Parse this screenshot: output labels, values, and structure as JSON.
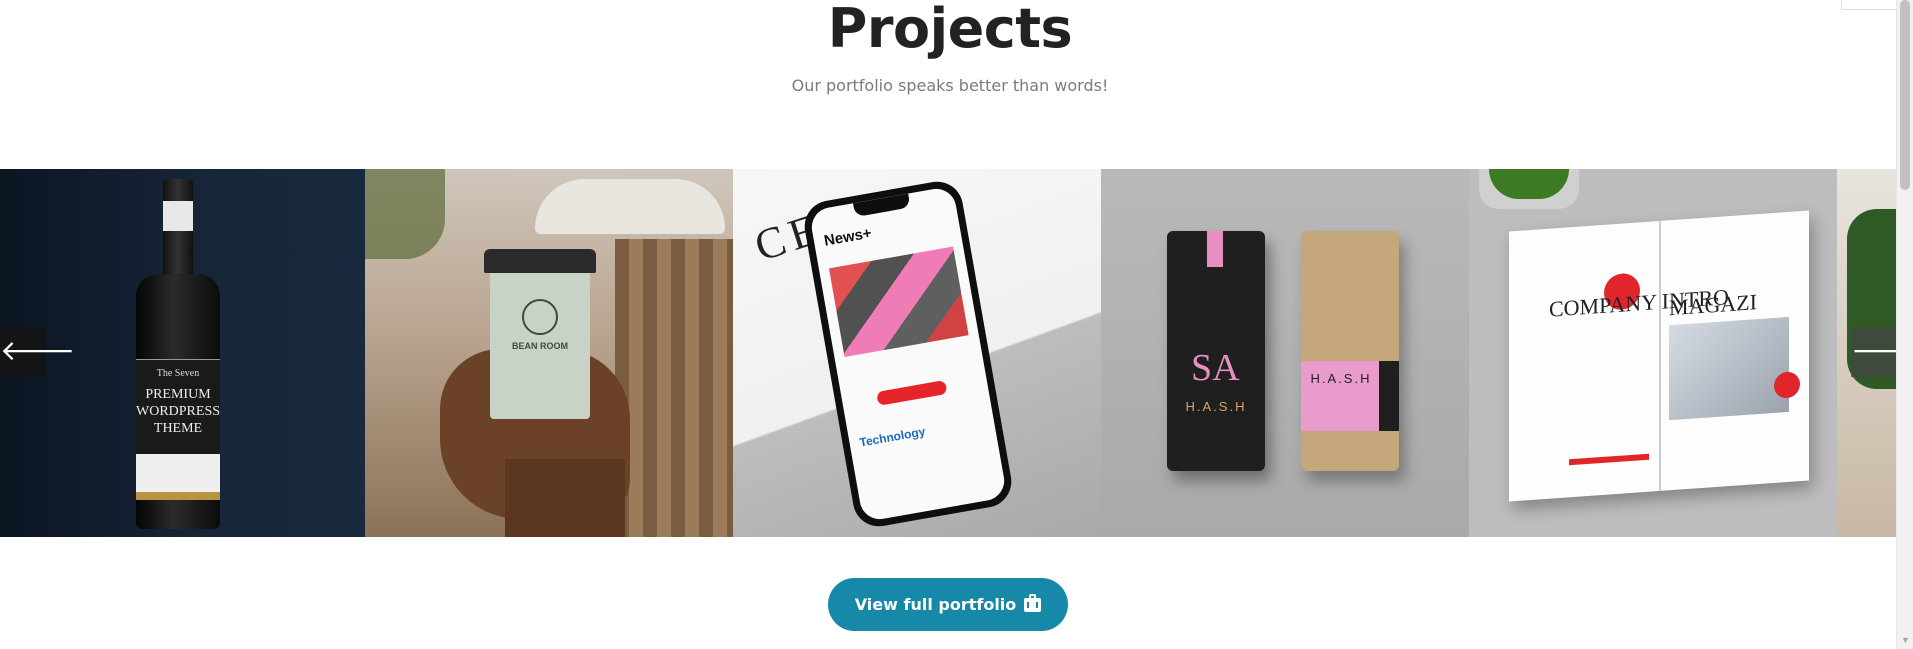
{
  "section": {
    "title": "Projects",
    "subtitle": "Our portfolio speaks better than words!"
  },
  "slides": [
    {
      "name": "wine-bottle",
      "text_small": "The Seven",
      "text_main": "PREMIUM WORDPRESS THEME"
    },
    {
      "name": "coffee-cup",
      "text": "BEAN ROOM"
    },
    {
      "name": "phone-news",
      "text_big": "CERE",
      "header": "News+",
      "section": "Technology"
    },
    {
      "name": "coffee-bags",
      "brand": "H.A.S.H",
      "monogram": "SA"
    },
    {
      "name": "magazine",
      "left_title": "COMPANY INTRO",
      "right_title": "MAGAZI"
    },
    {
      "name": "plant-partial"
    }
  ],
  "carousel": {
    "prev_icon": "arrow-left-icon",
    "next_icon": "arrow-right-icon",
    "prev_glyph": "🡐",
    "next_glyph": "🡒"
  },
  "cta": {
    "label": "View full portfolio",
    "icon": "briefcase-icon",
    "color": "#1688a8"
  }
}
